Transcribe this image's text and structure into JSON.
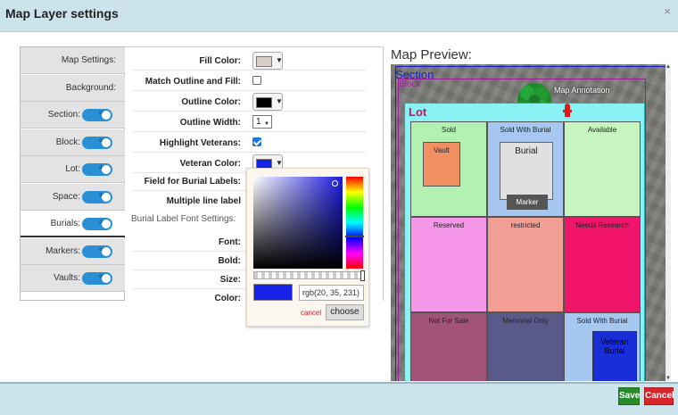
{
  "header": {
    "title": "Map Layer settings",
    "close_icon": "×"
  },
  "tabs": [
    {
      "label": "Map Settings:",
      "toggle": false
    },
    {
      "label": "Background:",
      "toggle": false
    },
    {
      "label": "Section:",
      "toggle": true
    },
    {
      "label": "Block:",
      "toggle": true
    },
    {
      "label": "Lot:",
      "toggle": true
    },
    {
      "label": "Space:",
      "toggle": true
    },
    {
      "label": "Burials:",
      "toggle": true,
      "active": true
    },
    {
      "label": "Markers:",
      "toggle": true
    },
    {
      "label": "Vaults:",
      "toggle": true
    }
  ],
  "toggle_text": "on",
  "form": {
    "fill_color": {
      "label": "Fill Color:",
      "color": "#d8d0c8"
    },
    "match": {
      "label": "Match Outline and Fill:",
      "checked": false
    },
    "outline_color": {
      "label": "Outline Color:",
      "color": "#000000"
    },
    "outline_width": {
      "label": "Outline Width:",
      "value": "1"
    },
    "highlight": {
      "label": "Highlight Veterans:",
      "checked": true
    },
    "veteran_color": {
      "label": "Veteran Color:",
      "color": "#1423e7"
    },
    "field_burial": {
      "label": "Field for Burial Labels:"
    },
    "multiline": {
      "label": "Multiple line label"
    },
    "section_label": "Burial Label Font Settings:",
    "font": {
      "label": "Font:"
    },
    "bold": {
      "label": "Bold:"
    },
    "size": {
      "label": "Size:"
    },
    "color": {
      "label": "Color:"
    }
  },
  "picker": {
    "rgb_value": "rgb(20, 35, 231)",
    "cancel": "cancel",
    "choose": "choose"
  },
  "map": {
    "title": "Map Preview:",
    "section": "Section",
    "block": "Block",
    "lot": "Lot",
    "annotation": "Map Annotation",
    "cells": [
      {
        "label": "Sold",
        "color": "#b3f1b3"
      },
      {
        "label": "Sold With Burial",
        "color": "#a6c8f0"
      },
      {
        "label": "Available",
        "color": "#c6f5c0"
      },
      {
        "label": "Reserved",
        "color": "#f597e8"
      },
      {
        "label": "restricted",
        "color": "#f29e95"
      },
      {
        "label": "Needs Research",
        "color": "#f0146a"
      },
      {
        "label": "Not For Sale",
        "color": "#a25378"
      },
      {
        "label": "Memorial Only",
        "color": "#5a5a8a"
      },
      {
        "label": "Sold With Burial",
        "color": "#a6c8f0"
      }
    ],
    "vault": "Vault",
    "burial": "Burial",
    "marker": "Marker",
    "veteran": "Veteran Burial"
  },
  "footer": {
    "save": "Save",
    "cancel": "Cancel"
  }
}
